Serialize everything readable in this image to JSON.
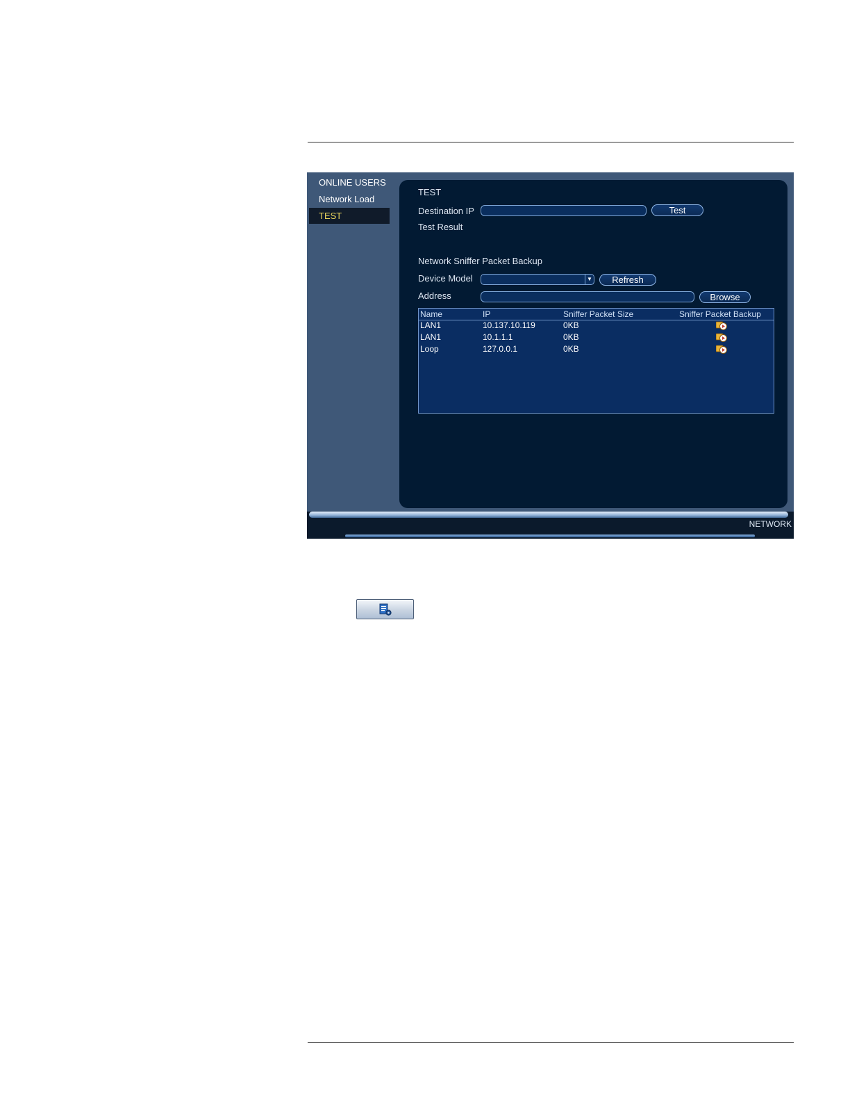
{
  "sidebar": {
    "items": [
      {
        "label": "ONLINE USERS"
      },
      {
        "label": "Network Load"
      },
      {
        "label": "TEST"
      }
    ]
  },
  "test": {
    "title": "TEST",
    "destination_ip_label": "Destination IP",
    "destination_ip_value": "",
    "test_button": "Test",
    "test_result_label": "Test Result"
  },
  "sniffer": {
    "title": "Network Sniffer Packet Backup",
    "device_model_label": "Device Model",
    "device_model_value": "",
    "refresh_button": "Refresh",
    "address_label": "Address",
    "address_value": "",
    "browse_button": "Browse",
    "columns": [
      "Name",
      "IP",
      "Sniffer Packet Size",
      "Sniffer Packet Backup"
    ],
    "rows": [
      {
        "name": "LAN1",
        "ip": "10.137.10.119",
        "size": "0KB",
        "backup_icon": "backup-play-icon"
      },
      {
        "name": "LAN1",
        "ip": "10.1.1.1",
        "size": "0KB",
        "backup_icon": "backup-play-icon"
      },
      {
        "name": "Loop",
        "ip": "127.0.0.1",
        "size": "0KB",
        "backup_icon": "backup-play-icon"
      }
    ]
  },
  "footer": {
    "label": "NETWORK"
  },
  "colors": {
    "panel": "#021a33",
    "sidebar": "#3f5878",
    "active_text": "#e8d35c"
  },
  "icons": {
    "tool_button": "document-settings-icon"
  }
}
